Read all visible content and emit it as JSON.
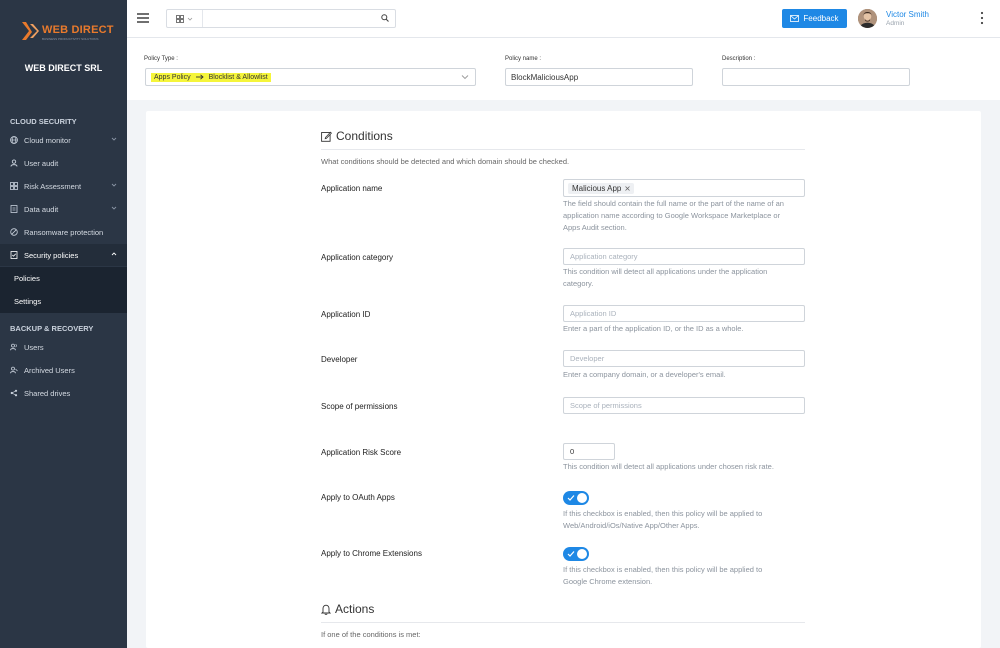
{
  "sidebar": {
    "logo_text": "WEB DIRECT",
    "logo_sub": "BUSINESS PRODUCTIVITY SOLUTIONS",
    "company": "WEB DIRECT SRL",
    "section_cloud": "CLOUD SECURITY",
    "items": [
      {
        "label": "Cloud monitor",
        "icon": "globe-icon"
      },
      {
        "label": "User audit",
        "icon": "user-icon"
      },
      {
        "label": "Risk Assessment",
        "icon": "grid-icon"
      },
      {
        "label": "Data audit",
        "icon": "document-icon"
      },
      {
        "label": "Ransomware protection",
        "icon": "shield-icon"
      },
      {
        "label": "Security policies",
        "icon": "policy-icon"
      }
    ],
    "sub_items": [
      {
        "label": "Policies"
      },
      {
        "label": "Settings"
      }
    ],
    "section_backup": "BACKUP & RECOVERY",
    "backup_items": [
      {
        "label": "Users",
        "icon": "users-icon"
      },
      {
        "label": "Archived Users",
        "icon": "archived-users-icon"
      },
      {
        "label": "Shared drives",
        "icon": "share-icon"
      }
    ]
  },
  "topbar": {
    "search_placeholder": "",
    "feedback_label": "Feedback",
    "user_name": "Victor Smith",
    "user_role": "Admin",
    "accent_color": "#1e88e5"
  },
  "policy": {
    "type_label": "Policy Type :",
    "type_value_a": "Apps Policy",
    "type_value_b": "Blocklist & Allowlist",
    "name_label": "Policy name :",
    "name_value": "BlockMaliciousApp",
    "description_label": "Description :",
    "description_value": ""
  },
  "conditions": {
    "title": "Conditions",
    "desc": "What conditions should be detected and which domain should be checked.",
    "app_name_label": "Application name",
    "app_name_chip": "Malicious App",
    "app_name_help_1": "The field should contain the full name or the part of the name of an",
    "app_name_help_2": "application name according to Google Workspace Marketplace or",
    "app_name_help_3": "Apps Audit section.",
    "category_label": "Application category",
    "category_placeholder": "Application category",
    "category_help_1": "This condition will detect all applications under the application",
    "category_help_2": "category.",
    "app_id_label": "Application ID",
    "app_id_placeholder": "Application ID",
    "app_id_help": "Enter a part of the application ID, or the ID as a whole.",
    "developer_label": "Developer",
    "developer_placeholder": "Developer",
    "developer_help": "Enter a company domain, or a developer's email.",
    "scope_label": "Scope of permissions",
    "scope_placeholder": "Scope of permissions",
    "risk_label": "Application Risk Score",
    "risk_value": "0",
    "risk_help": "This condition will detect all applications under chosen risk rate.",
    "oauth_label": "Apply to OAuth Apps",
    "oauth_enabled": true,
    "oauth_help_1": "If this checkbox is enabled, then this policy will be applied to",
    "oauth_help_2": "Web/Android/iOs/Native App/Other Apps.",
    "chrome_label": "Apply to Chrome Extensions",
    "chrome_enabled": true,
    "chrome_help_1": "If this checkbox is enabled, then this policy will be applied to",
    "chrome_help_2": "Google Chrome extension."
  },
  "actions": {
    "title": "Actions",
    "desc": "If one of the conditions is met:"
  }
}
